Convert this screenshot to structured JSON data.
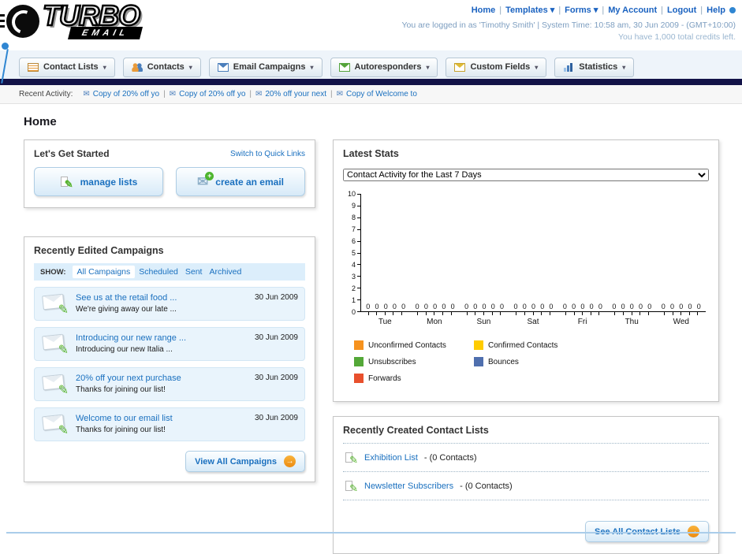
{
  "header": {
    "logo": {
      "title": "TURBO",
      "subtitle": "EMAIL"
    },
    "nav_links": [
      {
        "label": "Home",
        "caret": false
      },
      {
        "label": "Templates",
        "caret": true
      },
      {
        "label": "Forms",
        "caret": true
      },
      {
        "label": "My Account",
        "caret": false
      },
      {
        "label": "Logout",
        "caret": false
      },
      {
        "label": "Help",
        "caret": false
      }
    ],
    "login_info": "You are logged in as 'Timothy Smith' | System Time: 10:58 am, 30 Jun 2009 - (GMT+10:00)",
    "credits_info": "You have 1,000 total credits left."
  },
  "main_nav": [
    {
      "label": "Contact Lists",
      "icon": "contact-lists"
    },
    {
      "label": "Contacts",
      "icon": "contacts"
    },
    {
      "label": "Email Campaigns",
      "icon": "email"
    },
    {
      "label": "Autoresponders",
      "icon": "auto"
    },
    {
      "label": "Custom Fields",
      "icon": "fields"
    },
    {
      "label": "Statistics",
      "icon": "stats"
    }
  ],
  "recent_activity": {
    "label": "Recent Activity:",
    "items": [
      "Copy of 20% off yo",
      "Copy of 20% off yo",
      "20% off your next",
      "Copy of Welcome to"
    ]
  },
  "page_title": "Home",
  "get_started": {
    "title": "Let's Get Started",
    "switch_link": "Switch to Quick Links",
    "buttons": [
      {
        "label": "manage lists",
        "icon": "pencil"
      },
      {
        "label": "create an email",
        "icon": "email-plus"
      }
    ]
  },
  "campaigns": {
    "title": "Recently Edited Campaigns",
    "show_label": "SHOW:",
    "filters": [
      {
        "label": "All Campaigns",
        "active": true
      },
      {
        "label": "Scheduled",
        "active": false
      },
      {
        "label": "Sent",
        "active": false
      },
      {
        "label": "Archived",
        "active": false
      }
    ],
    "items": [
      {
        "title": "See us at the retail food ...",
        "subtitle": "We're giving away our late ...",
        "date": "30 Jun 2009"
      },
      {
        "title": "Introducing our new range ...",
        "subtitle": "Introducing our new Italia ...",
        "date": "30 Jun 2009"
      },
      {
        "title": "20% off your next purchase",
        "subtitle": "Thanks for joining our list!",
        "date": "30 Jun 2009"
      },
      {
        "title": "Welcome to our email list",
        "subtitle": "Thanks for joining our list!",
        "date": "30 Jun 2009"
      }
    ],
    "view_all_label": "View All Campaigns"
  },
  "stats": {
    "title": "Latest Stats",
    "filter_value": "Contact Activity for the Last 7 Days"
  },
  "chart_data": {
    "type": "bar",
    "title": "Contact Activity for the Last 7 Days",
    "categories": [
      "Tue",
      "Mon",
      "Sun",
      "Sat",
      "Fri",
      "Thu",
      "Wed"
    ],
    "series": [
      {
        "name": "Unconfirmed Contacts",
        "color": "#F6921E",
        "values": [
          0,
          0,
          0,
          0,
          0,
          0,
          0
        ]
      },
      {
        "name": "Confirmed Contacts",
        "color": "#FFCC00",
        "values": [
          0,
          0,
          0,
          0,
          0,
          0,
          0
        ]
      },
      {
        "name": "Unsubscribes",
        "color": "#54A838",
        "values": [
          0,
          0,
          0,
          0,
          0,
          0,
          0
        ]
      },
      {
        "name": "Bounces",
        "color": "#4F6FAE",
        "values": [
          0,
          0,
          0,
          0,
          0,
          0,
          0
        ]
      },
      {
        "name": "Forwards",
        "color": "#E8502D",
        "values": [
          0,
          0,
          0,
          0,
          0,
          0,
          0
        ]
      }
    ],
    "ylim": [
      0,
      10
    ],
    "yticks": [
      0,
      1,
      2,
      3,
      4,
      5,
      6,
      7,
      8,
      9,
      10
    ],
    "grid": false,
    "legend_position": "bottom"
  },
  "contact_lists": {
    "title": "Recently Created Contact Lists",
    "items": [
      {
        "name": "Exhibition List",
        "detail": "- (0 Contacts)"
      },
      {
        "name": "Newsletter Subscribers",
        "detail": "- (0 Contacts)"
      }
    ],
    "see_all_label": "See All Contact Lists"
  }
}
